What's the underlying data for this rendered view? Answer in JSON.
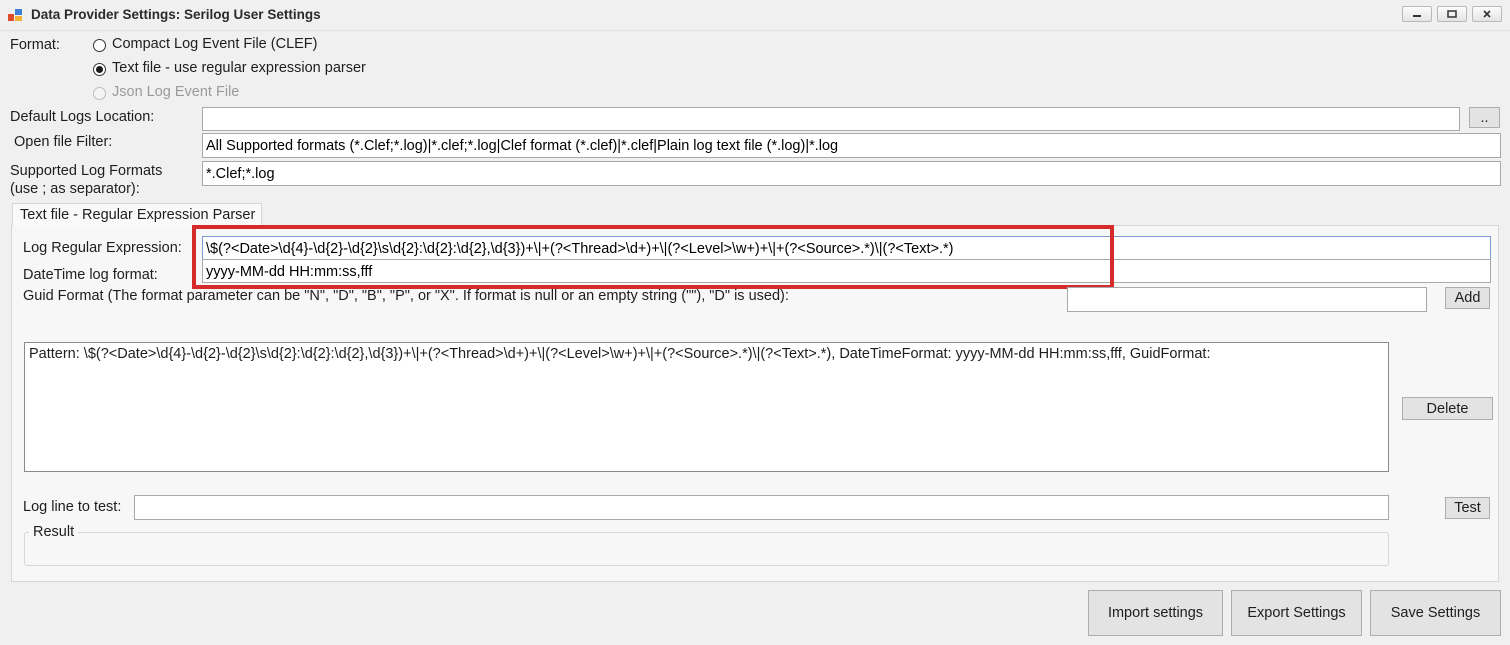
{
  "window": {
    "title": "Data Provider Settings: Serilog User Settings",
    "controls": {
      "minimize": "minimize-icon",
      "maximize": "maximize-icon",
      "close": "close-icon"
    }
  },
  "format": {
    "label": "Format:",
    "options": [
      {
        "label": "Compact Log Event File (CLEF)",
        "checked": false,
        "enabled": true
      },
      {
        "label": "Text file - use regular expression parser",
        "checked": true,
        "enabled": true
      },
      {
        "label": "Json Log Event File",
        "checked": false,
        "enabled": false
      }
    ]
  },
  "default_logs": {
    "label": "Default Logs Location:",
    "value": "",
    "browse_label": ".."
  },
  "open_filter": {
    "label": "Open file Filter:",
    "value": "All Supported formats (*.Clef;*.log)|*.clef;*.log|Clef format (*.clef)|*.clef|Plain log text file (*.log)|*.log"
  },
  "supported_formats": {
    "label_line1": "Supported Log Formats",
    "label_line2": "(use ; as separator):",
    "value": "*.Clef;*.log"
  },
  "tab": {
    "label": "Text file - Regular Expression Parser",
    "regex": {
      "label": "Log Regular Expression:",
      "value": "\\$(?<Date>\\d{4}-\\d{2}-\\d{2}\\s\\d{2}:\\d{2}:\\d{2},\\d{3})+\\|+(?<Thread>\\d+)+\\|(?<Level>\\w+)+\\|+(?<Source>.*)\\|(?<Text>.*)"
    },
    "datetime": {
      "label": "DateTime log format:",
      "value": "yyyy-MM-dd HH:mm:ss,fff"
    },
    "guid": {
      "label": "Guid Format (The format parameter can be \"N\", \"D\", \"B\", \"P\", or \"X\". If format is null or an empty string (\"\"), \"D\" is used):",
      "value": "",
      "add_label": "Add"
    },
    "patterns": [
      "Pattern: \\$(?<Date>\\d{4}-\\d{2}-\\d{2}\\s\\d{2}:\\d{2}:\\d{2},\\d{3})+\\|+(?<Thread>\\d+)+\\|(?<Level>\\w+)+\\|+(?<Source>.*)\\|(?<Text>.*), DateTimeFormat: yyyy-MM-dd HH:mm:ss,fff, GuidFormat:"
    ],
    "delete_label": "Delete",
    "test": {
      "label": "Log line to test:",
      "value": "",
      "button_label": "Test"
    },
    "result": {
      "label": "Result"
    }
  },
  "footer": {
    "import_label": "Import settings",
    "export_label": "Export Settings",
    "save_label": "Save Settings"
  },
  "colors": {
    "highlight": "#d52b2b",
    "window_bg": "#f0f0f0"
  }
}
